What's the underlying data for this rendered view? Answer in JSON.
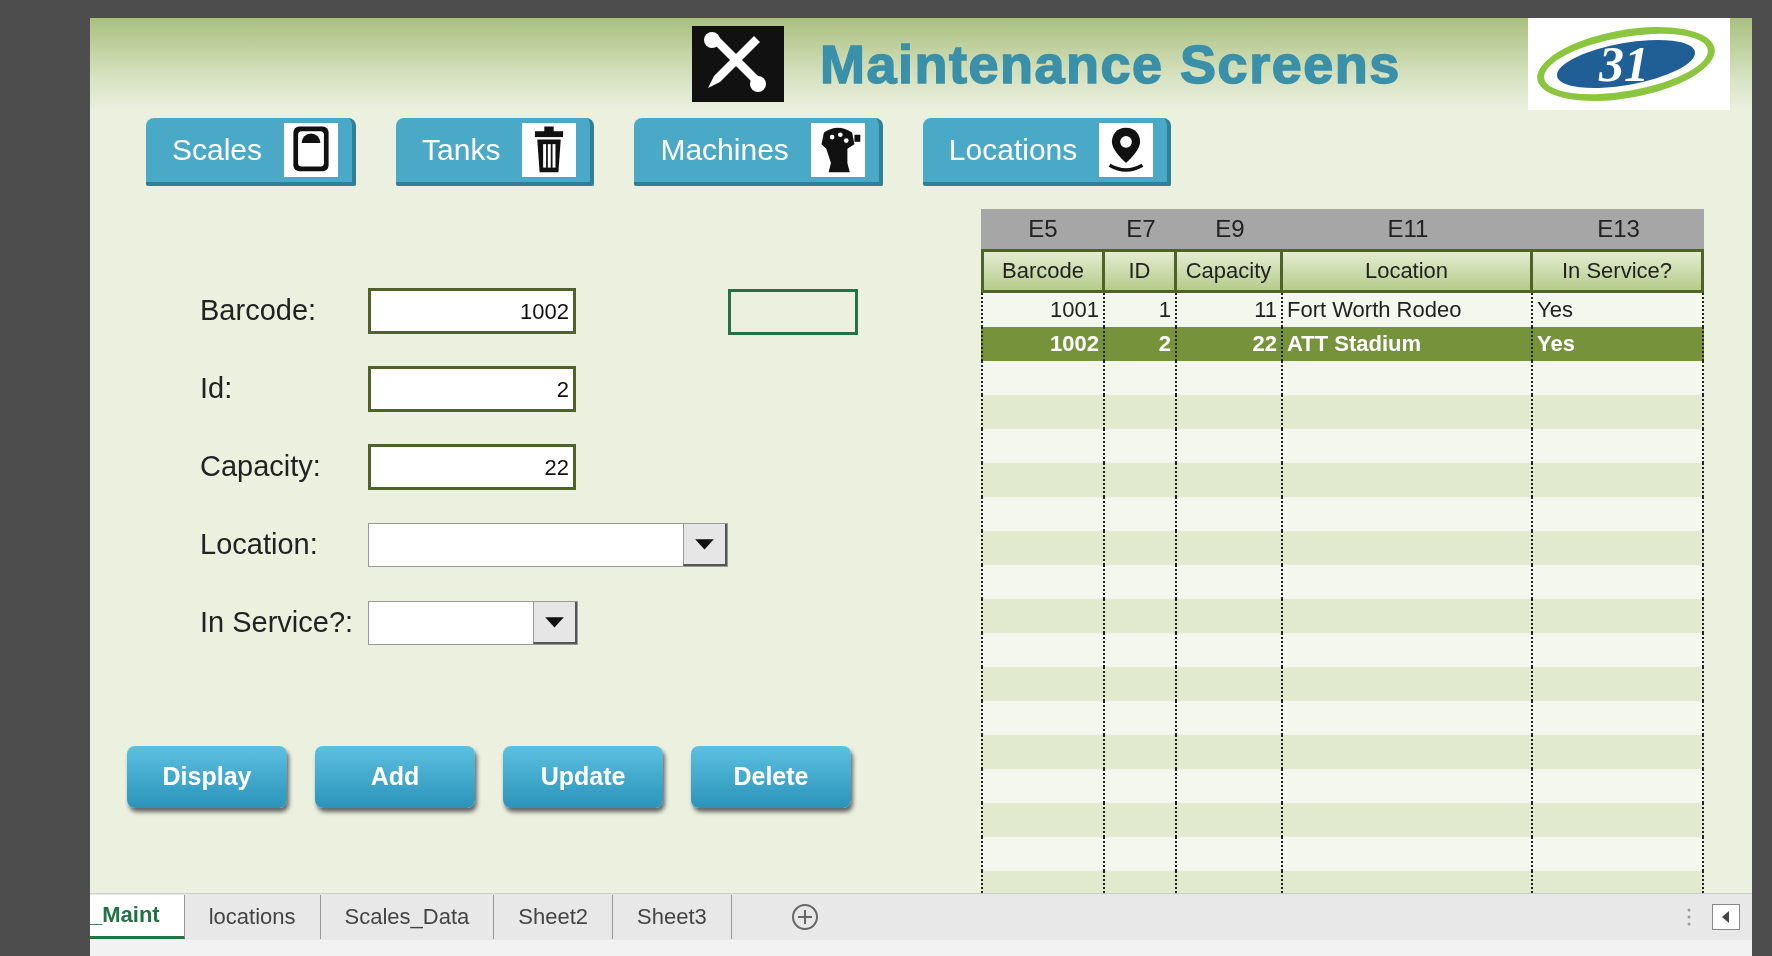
{
  "header": {
    "title": "Maintenance Screens",
    "logo_text": "31"
  },
  "nav_buttons": [
    {
      "label": "Scales"
    },
    {
      "label": "Tanks"
    },
    {
      "label": "Machines"
    },
    {
      "label": "Locations"
    }
  ],
  "form": {
    "fields": [
      {
        "kind": "text",
        "label": "Barcode:",
        "value": "1002"
      },
      {
        "kind": "text",
        "label": "Id:",
        "value": "2"
      },
      {
        "kind": "text",
        "label": "Capacity:",
        "value": "22"
      },
      {
        "kind": "dropdown",
        "label": "Location:"
      },
      {
        "kind": "dropdown",
        "label": "In Service?:"
      }
    ]
  },
  "actions": [
    "Display",
    "Add",
    "Update",
    "Delete"
  ],
  "table": {
    "column_letters": [
      "E5",
      "E7",
      "E9",
      "E11",
      "E13"
    ],
    "columns": [
      "Barcode",
      "ID",
      "Capacity",
      "Location",
      "In Service?"
    ],
    "rows": [
      {
        "selected": false,
        "cells": [
          "1001",
          "1",
          "11",
          "Fort Worth Rodeo",
          "Yes"
        ]
      },
      {
        "selected": true,
        "cells": [
          "1002",
          "2",
          "22",
          "ATT Stadium",
          "Yes"
        ]
      }
    ]
  },
  "sheet_tabs": [
    {
      "label": "_Maint",
      "selected": true
    },
    {
      "label": "locations",
      "selected": false
    },
    {
      "label": "Scales_Data",
      "selected": false
    },
    {
      "label": "Sheet2",
      "selected": false
    },
    {
      "label": "Sheet3",
      "selected": false
    }
  ]
}
